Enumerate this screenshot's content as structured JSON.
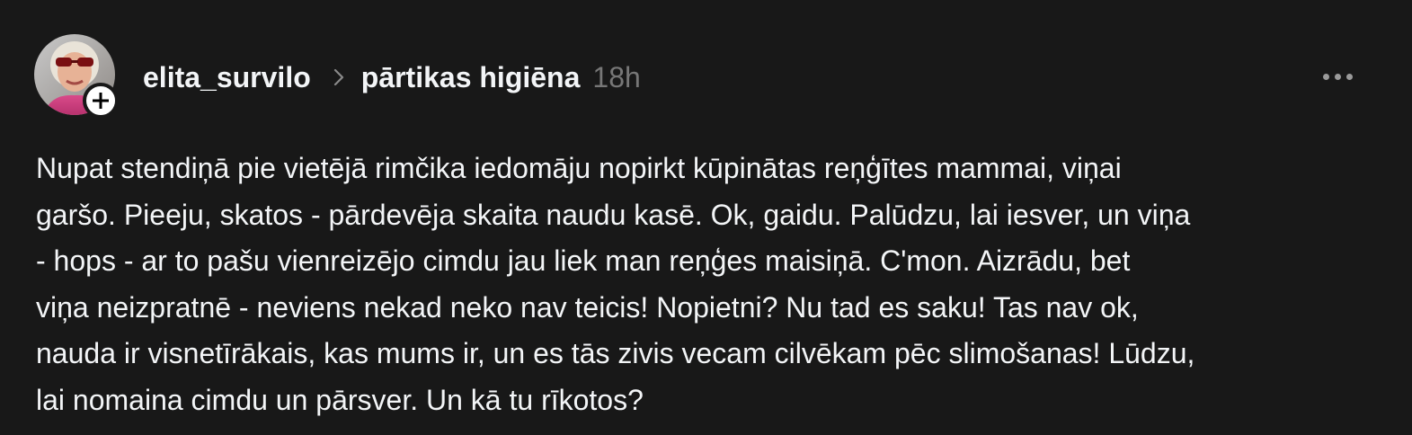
{
  "post": {
    "author": {
      "username": "elita_survilo",
      "avatar_icon": "profile-photo"
    },
    "topic": "pārtikas higiēna",
    "time": "18h",
    "more_icon": "more-horizontal-icon",
    "text_lines": [
      "Nupat stendiņā pie vietējā rimčika iedomāju nopirkt kūpinātas reņģītes mammai, viņai",
      "garšo. Pieeju, skatos - pārdevēja skaita naudu kasē. Ok, gaidu. Palūdzu, lai iesver, un viņa",
      "- hops - ar to pašu vienreizējo cimdu jau liek man reņģes maisiņā. C'mon. Aizrādu, bet",
      "viņa neizpratnē - neviens nekad neko nav teicis! Nopietni? Nu tad es saku! Tas nav ok,",
      "nauda ir visnetīrākais, kas mums ir, un es tās zivis vecam cilvēkam pēc slimošanas! Lūdzu,",
      "lai nomaina cimdu un pārsver. Un kā tu rīkotos?"
    ]
  },
  "colors": {
    "background": "#181818",
    "primary_text": "#f3f5f7",
    "secondary_text": "#777777",
    "badge_bg": "#ffffff"
  }
}
